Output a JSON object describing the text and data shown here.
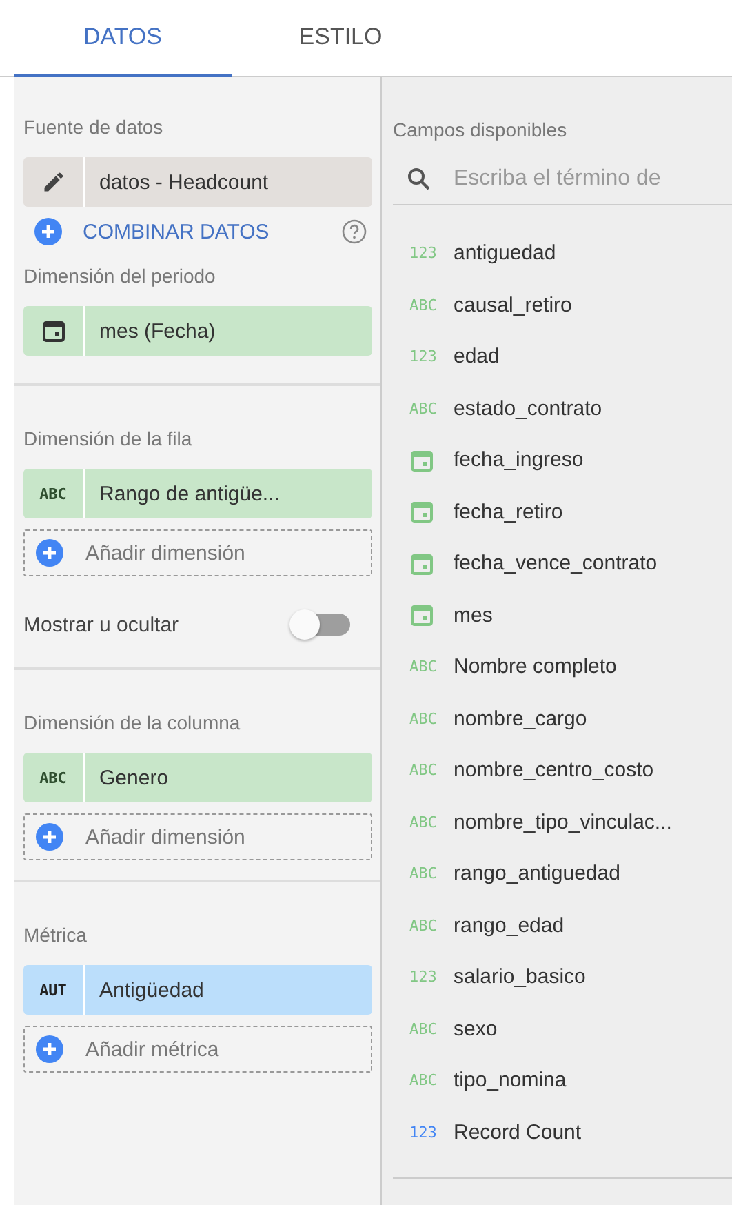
{
  "tabs": [
    {
      "label": "DATOS",
      "selected": true
    },
    {
      "label": "ESTILO",
      "selected": false
    }
  ],
  "data_source": {
    "heading": "Fuente de datos",
    "name": "datos - Headcount",
    "blend_link": "COMBINAR DATOS"
  },
  "period": {
    "heading": "Dimensión del periodo",
    "chip": {
      "kind": "date",
      "label": "mes (Fecha)"
    }
  },
  "row_dimension": {
    "heading": "Dimensión de la fila",
    "chip": {
      "kind": "dimension",
      "badge": "ABC",
      "label": "Rango de antigüe..."
    },
    "add_label": "Añadir dimensión",
    "toggle": {
      "label": "Mostrar u ocultar",
      "on": false
    }
  },
  "column_dimension": {
    "heading": "Dimensión de la columna",
    "chip": {
      "kind": "dimension",
      "badge": "ABC",
      "label": "Genero"
    },
    "add_label": "Añadir dimensión"
  },
  "metric": {
    "heading": "Métrica",
    "chip": {
      "kind": "metric",
      "badge": "AUT",
      "label": "Antigüedad"
    },
    "add_label": "Añadir métrica"
  },
  "available_fields": {
    "heading": "Campos disponibles",
    "search": {
      "placeholder": "Escriba el término de"
    },
    "fields": [
      {
        "kind": "number",
        "badge": "123",
        "name": "antiguedad",
        "color": "#81c784"
      },
      {
        "kind": "text",
        "badge": "ABC",
        "name": "causal_retiro",
        "color": "#81c784"
      },
      {
        "kind": "number",
        "badge": "123",
        "name": "edad",
        "color": "#81c784"
      },
      {
        "kind": "text",
        "badge": "ABC",
        "name": "estado_contrato",
        "color": "#81c784"
      },
      {
        "kind": "date",
        "name": "fecha_ingreso",
        "color": "#81c784"
      },
      {
        "kind": "date",
        "name": "fecha_retiro",
        "color": "#81c784"
      },
      {
        "kind": "date",
        "name": "fecha_vence_contrato",
        "color": "#81c784"
      },
      {
        "kind": "date",
        "name": "mes",
        "color": "#81c784"
      },
      {
        "kind": "text",
        "badge": "ABC",
        "name": "Nombre completo",
        "color": "#81c784"
      },
      {
        "kind": "text",
        "badge": "ABC",
        "name": "nombre_cargo",
        "color": "#81c784"
      },
      {
        "kind": "text",
        "badge": "ABC",
        "name": "nombre_centro_costo",
        "color": "#81c784"
      },
      {
        "kind": "text",
        "badge": "ABC",
        "name": "nombre_tipo_vinculac...",
        "color": "#81c784"
      },
      {
        "kind": "text",
        "badge": "ABC",
        "name": "rango_antiguedad",
        "color": "#81c784"
      },
      {
        "kind": "text",
        "badge": "ABC",
        "name": "rango_edad",
        "color": "#81c784"
      },
      {
        "kind": "number",
        "badge": "123",
        "name": "salario_basico",
        "color": "#81c784"
      },
      {
        "kind": "text",
        "badge": "ABC",
        "name": "sexo",
        "color": "#81c784"
      },
      {
        "kind": "text",
        "badge": "ABC",
        "name": "tipo_nomina",
        "color": "#81c784"
      },
      {
        "kind": "number",
        "badge": "123",
        "name": "Record Count",
        "color": "#4285f4"
      }
    ]
  }
}
